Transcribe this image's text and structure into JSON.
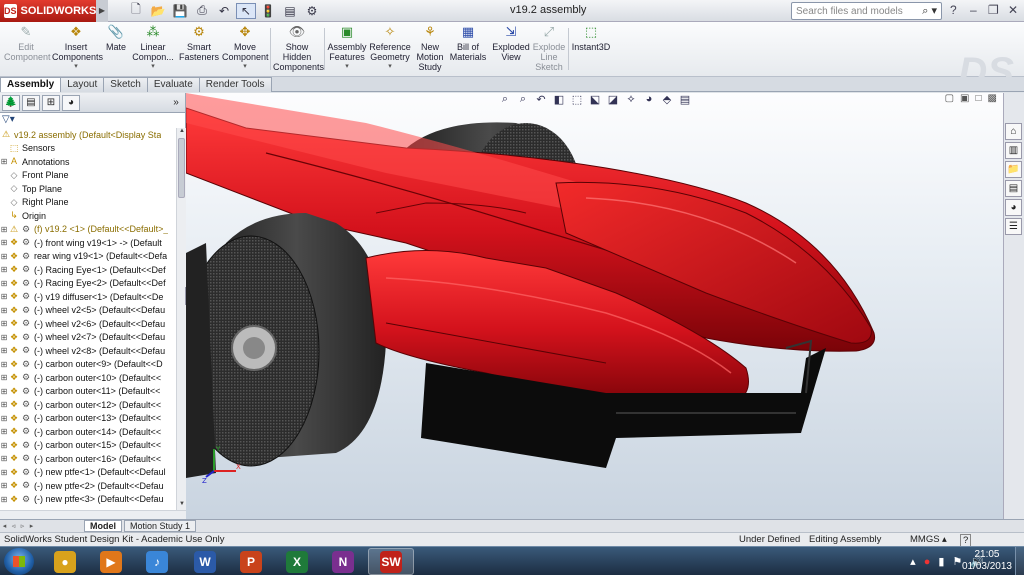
{
  "app": {
    "brand": "SOLIDWORKS",
    "document_title": "v19.2 assembly",
    "search_placeholder": "Search files and models"
  },
  "commands": [
    {
      "label": "Edit Component",
      "icon": "edit-component-icon",
      "enabled": false
    },
    {
      "label": "Insert Components",
      "icon": "insert-components-icon",
      "enabled": true
    },
    {
      "label": "Mate",
      "icon": "mate-icon",
      "enabled": true
    },
    {
      "label": "Linear Compon...",
      "icon": "linear-pattern-icon",
      "enabled": true
    },
    {
      "label": "Smart Fasteners",
      "icon": "smart-fasteners-icon",
      "enabled": true
    },
    {
      "label": "Move Component",
      "icon": "move-component-icon",
      "enabled": true
    },
    {
      "label": "Show Hidden Components",
      "icon": "show-hidden-icon",
      "enabled": true
    },
    {
      "label": "Assembly Features",
      "icon": "assembly-features-icon",
      "enabled": true
    },
    {
      "label": "Reference Geometry",
      "icon": "reference-geometry-icon",
      "enabled": true
    },
    {
      "label": "New Motion Study",
      "icon": "motion-study-icon",
      "enabled": true
    },
    {
      "label": "Bill of Materials",
      "icon": "bom-icon",
      "enabled": true
    },
    {
      "label": "Exploded View",
      "icon": "exploded-view-icon",
      "enabled": true
    },
    {
      "label": "Explode Line Sketch",
      "icon": "explode-line-icon",
      "enabled": false
    },
    {
      "label": "Instant3D",
      "icon": "instant3d-icon",
      "enabled": true
    }
  ],
  "tabs": [
    "Assembly",
    "Layout",
    "Sketch",
    "Evaluate",
    "Render Tools"
  ],
  "active_tab": "Assembly",
  "tree": {
    "root": "v19.2 assembly  (Default<Display Sta",
    "items": [
      {
        "label": "Sensors",
        "icon": "sensors-icon",
        "expandable": false
      },
      {
        "label": "Annotations",
        "icon": "annotations-icon",
        "expandable": true
      },
      {
        "label": "Front Plane",
        "icon": "plane-icon",
        "expandable": false
      },
      {
        "label": "Top Plane",
        "icon": "plane-icon",
        "expandable": false
      },
      {
        "label": "Right Plane",
        "icon": "plane-icon",
        "expandable": false
      },
      {
        "label": "Origin",
        "icon": "origin-icon",
        "expandable": false
      },
      {
        "label": "(f) v19.2 <1> (Default<<Default>_",
        "icon": "part-warning-icon",
        "expandable": true,
        "warn": true
      },
      {
        "label": "(-) front wing v19<1> -> (Default",
        "icon": "part-icon",
        "expandable": true
      },
      {
        "label": "rear wing v19<1> (Default<<Defa",
        "icon": "part-icon",
        "expandable": true
      },
      {
        "label": "(-) Racing Eye<1> (Default<<Def",
        "icon": "part-icon",
        "expandable": true
      },
      {
        "label": "(-) Racing Eye<2> (Default<<Def",
        "icon": "part-icon",
        "expandable": true
      },
      {
        "label": "(-) v19 diffuser<1> (Default<<De",
        "icon": "part-icon",
        "expandable": true
      },
      {
        "label": "(-) wheel v2<5> (Default<<Defau",
        "icon": "part-icon",
        "expandable": true
      },
      {
        "label": "(-) wheel v2<6> (Default<<Defau",
        "icon": "part-icon",
        "expandable": true
      },
      {
        "label": "(-) wheel v2<7> (Default<<Defau",
        "icon": "part-icon",
        "expandable": true
      },
      {
        "label": "(-) wheel v2<8> (Default<<Defau",
        "icon": "part-icon",
        "expandable": true
      },
      {
        "label": "(-) carbon outer<9> (Default<<D",
        "icon": "part-icon",
        "expandable": true
      },
      {
        "label": "(-) carbon outer<10> (Default<<",
        "icon": "part-icon",
        "expandable": true
      },
      {
        "label": "(-) carbon outer<11> (Default<<",
        "icon": "part-icon",
        "expandable": true
      },
      {
        "label": "(-) carbon outer<12> (Default<<",
        "icon": "part-icon",
        "expandable": true
      },
      {
        "label": "(-) carbon outer<13> (Default<<",
        "icon": "part-icon",
        "expandable": true
      },
      {
        "label": "(-) carbon outer<14> (Default<<",
        "icon": "part-icon",
        "expandable": true
      },
      {
        "label": "(-) carbon outer<15> (Default<<",
        "icon": "part-icon",
        "expandable": true
      },
      {
        "label": "(-) carbon outer<16> (Default<<",
        "icon": "part-icon",
        "expandable": true
      },
      {
        "label": "(-) new ptfe<1> (Default<<Defaul",
        "icon": "part-icon",
        "expandable": true
      },
      {
        "label": "(-) new ptfe<2> (Default<<Defau",
        "icon": "part-icon",
        "expandable": true
      },
      {
        "label": "(-) new ptfe<3> (Default<<Defau",
        "icon": "part-icon",
        "expandable": true
      }
    ]
  },
  "bottom_tabs": [
    "Model",
    "Motion Study 1"
  ],
  "active_bottom_tab": "Model",
  "status": {
    "left": "SolidWorks Student Design Kit - Academic Use Only",
    "state": "Under Defined",
    "mode": "Editing Assembly",
    "units": "MMGS",
    "help": "?"
  },
  "taskbar": {
    "apps": [
      {
        "name": "Chrome",
        "icon": "chrome-icon",
        "glyph": "●",
        "color": "#d8a21c"
      },
      {
        "name": "Media Player",
        "icon": "media-player-icon",
        "glyph": "▶",
        "color": "#e0771a"
      },
      {
        "name": "iTunes",
        "icon": "itunes-icon",
        "glyph": "♪",
        "color": "#3a86d8"
      },
      {
        "name": "Word",
        "icon": "word-icon",
        "glyph": "W",
        "color": "#2b5aa8"
      },
      {
        "name": "PowerPoint",
        "icon": "powerpoint-icon",
        "glyph": "P",
        "color": "#c9431b"
      },
      {
        "name": "Excel",
        "icon": "excel-icon",
        "glyph": "X",
        "color": "#1f7a3a"
      },
      {
        "name": "OneNote",
        "icon": "onenote-icon",
        "glyph": "N",
        "color": "#7a2f8f"
      },
      {
        "name": "SolidWorks",
        "icon": "solidworks-icon",
        "glyph": "SW",
        "color": "#c0221a",
        "active": true
      }
    ],
    "time": "21:05",
    "date": "01/03/2013"
  },
  "colors": {
    "body": "#d4121c",
    "body_dark": "#7a0308",
    "tyre": "#2a2a2a",
    "diffuser": "#0c0c0c",
    "brand": "#c0221a"
  }
}
